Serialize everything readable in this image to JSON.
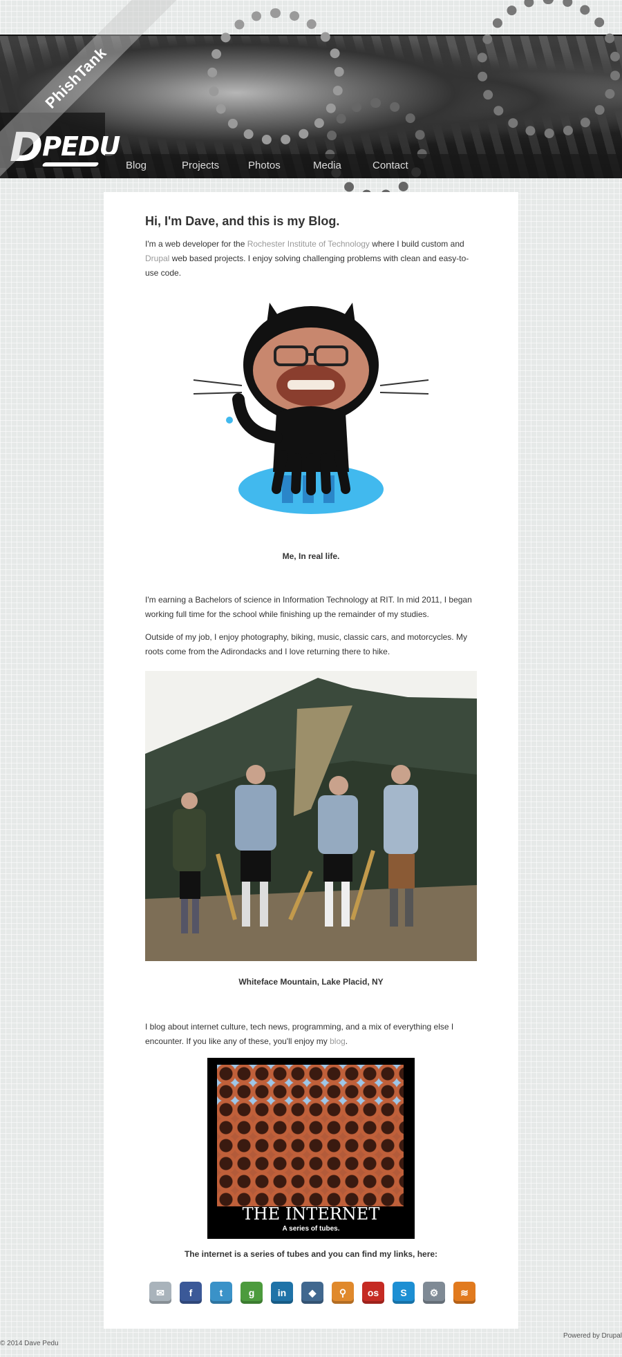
{
  "header": {
    "ribbon_text": "PhishTank",
    "logo_d": "D",
    "logo_rest": "PEDU"
  },
  "nav": {
    "items": [
      "Blog",
      "Projects",
      "Photos",
      "Media",
      "Contact"
    ]
  },
  "intro": {
    "heading": "Hi, I'm Dave, and this is my Blog.",
    "p1_a": "I'm a web developer for the ",
    "p1_link1": "Rochester Institute of Technology",
    "p1_b": " where I build custom and ",
    "p1_link2": "Drupal",
    "p1_c": " web based projects. I enjoy solving challenging problems with clean and easy-to-use code."
  },
  "photo1": {
    "caption": "Me, In real life."
  },
  "bio": {
    "p1": "I'm earning a Bachelors of science in Information Technology at RIT. In mid 2011, I began working full time for the school while finishing up the remainder of my studies.",
    "p2": "Outside of my job, I enjoy photography, biking, music, classic cars, and motorcycles. My roots come from the Adirondacks and I love returning there to hike."
  },
  "photo2": {
    "caption": "Whiteface Mountain, Lake Placid, NY"
  },
  "blog": {
    "p_a": "I blog about internet culture, tech news, programming, and a mix of everything else I encounter. If you like any of these, you'll enjoy my ",
    "p_link": "blog",
    "p_b": "."
  },
  "poster": {
    "title": "THE INTERNET",
    "subtitle": "A series of tubes."
  },
  "links": {
    "caption": "The internet is a series of tubes and you can find my links, here:"
  },
  "social": [
    {
      "name": "email",
      "glyph": "✉",
      "color": "#a9b3bb"
    },
    {
      "name": "facebook",
      "glyph": "f",
      "color": "#3b5998"
    },
    {
      "name": "twitter",
      "glyph": "t",
      "color": "#3a92c8"
    },
    {
      "name": "google",
      "glyph": "g",
      "color": "#4c9b3d"
    },
    {
      "name": "linkedin",
      "glyph": "in",
      "color": "#1f73a8"
    },
    {
      "name": "github",
      "glyph": "◆",
      "color": "#41688f"
    },
    {
      "name": "bike",
      "glyph": "⚲",
      "color": "#e0892c"
    },
    {
      "name": "lastfm",
      "glyph": "os",
      "color": "#c52b23"
    },
    {
      "name": "skype",
      "glyph": "S",
      "color": "#1d8fd3"
    },
    {
      "name": "steam",
      "glyph": "⚙",
      "color": "#7f8a95"
    },
    {
      "name": "rss",
      "glyph": "≋",
      "color": "#e17a1e"
    }
  ],
  "footer": {
    "copyright": "© 2014 Dave Pedu",
    "powered": "Powered by Drupal"
  }
}
